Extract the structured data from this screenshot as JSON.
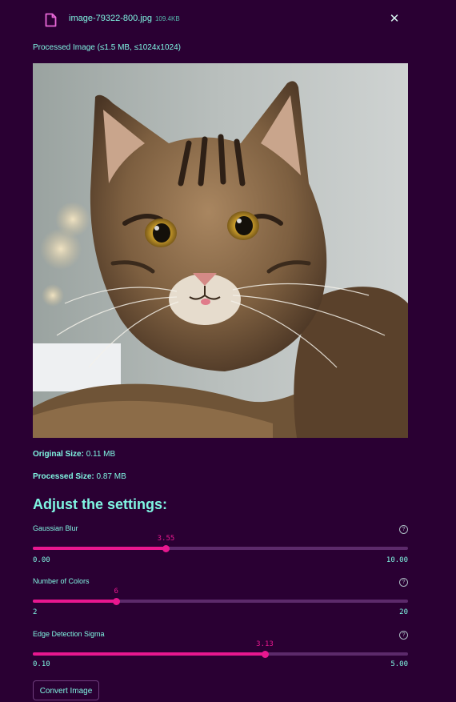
{
  "file": {
    "name": "image-79322-800.jpg",
    "size": "109.4KB",
    "icon": "file-icon",
    "close_symbol": "✕"
  },
  "caption": "Processed Image (≤1.5 MB, ≤1024x1024)",
  "image": {
    "subject": "tabby cat",
    "icon": "cat-photo"
  },
  "info": {
    "original_label": "Original Size:",
    "original_value": "0.11 MB",
    "processed_label": "Processed Size:",
    "processed_value": "0.87 MB"
  },
  "heading": "Adjust the settings:",
  "sliders": [
    {
      "label": "Gaussian Blur",
      "value": "3.55",
      "min": "0.00",
      "max": "10.00",
      "fraction": 0.355
    },
    {
      "label": "Number of Colors",
      "value": "6",
      "min": "2",
      "max": "20",
      "fraction": 0.2222
    },
    {
      "label": "Edge Detection Sigma",
      "value": "3.13",
      "min": "0.10",
      "max": "5.00",
      "fraction": 0.6184
    }
  ],
  "help_symbol": "?",
  "convert_button": "Convert Image",
  "colors": {
    "background": "#2a0033",
    "accent": "#e8178f",
    "text": "#7ff5e2",
    "track": "#5c2a6b"
  }
}
